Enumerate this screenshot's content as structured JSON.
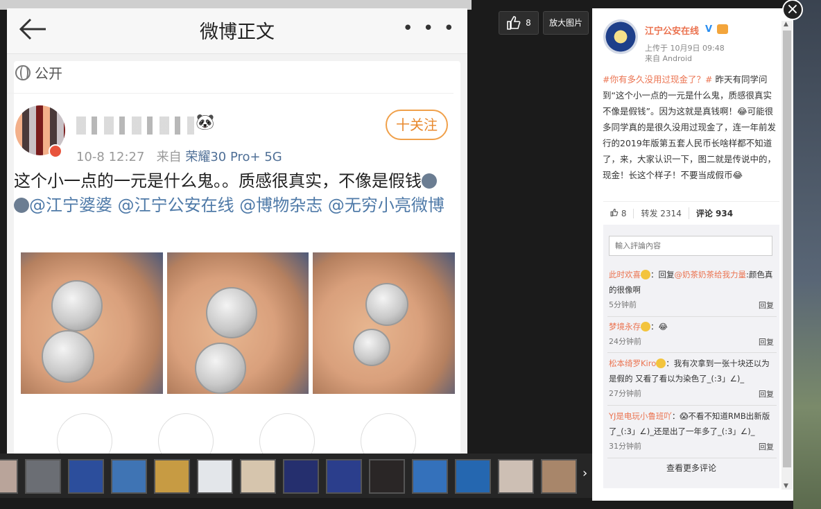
{
  "image_viewer": {
    "like_count": "8",
    "zoom_label": "放大图片",
    "close_label": "×",
    "next_label": "›",
    "thumbnail_count": "14"
  },
  "phone_screenshot": {
    "title": "微博正文",
    "more": "• • •",
    "visibility": "公开",
    "post_time": "10-8 12:27",
    "from_prefix": "来自",
    "device": "荣耀30 Pro+ 5G",
    "follow_label": "十关注",
    "text_main": "这个小一点的一元是什么鬼。。质感很真实，不像是假钱",
    "mentions": "@江宁婆婆 @江宁公安在线 @博物杂志 @无穷小亮微博"
  },
  "panel": {
    "author": "江宁公安在线",
    "verified_mark": "V",
    "upload_time": "上传于 10月9日 09:48",
    "source": "来自 Android",
    "tag": "#你有多久没用过现金了？#",
    "body": "昨天有同学问到“这个小一点的一元是什么鬼，质感很真实不像是假钱”。因为这就是真钱啊！😂可能很多同学真的是很久没用过现金了，连一年前发行的2019年版第五套人民币长啥样都不知道了，来，大家认识一下，图二就是传说中的，现金！长这个样子！不要当成假币😂",
    "actions": {
      "like": "8",
      "repost": "转发 2314",
      "comment": "评论 934"
    },
    "comment_placeholder": "輸入評論內容",
    "comments": [
      {
        "user": "此时欢喜",
        "text": "：回复",
        "mention": "@奶茶奶茶给我力量",
        "text2": ":颜色真的很像啊",
        "time": "5分钟前",
        "reply": "回复"
      },
      {
        "user": "梦境永存",
        "text": "：😂",
        "mention": "",
        "text2": "",
        "time": "24分钟前",
        "reply": "回复"
      },
      {
        "user": "松本绮罗Kiro",
        "text": "：我有次拿到一张十块还以为是假的 又看了看以为染色了_(:3」∠)_",
        "mention": "",
        "text2": "",
        "time": "27分钟前",
        "reply": "回复"
      },
      {
        "user": "YJ是电玩小鲁班吖",
        "text": "：😱不看不知道RMB出新版了_(:3」∠)_还是出了一年多了_(:3」∠)_",
        "mention": "",
        "text2": "",
        "time": "31分钟前",
        "reply": "回复"
      }
    ],
    "more_comments": "查看更多评论"
  },
  "colors": {
    "accent_orange": "#eb7350",
    "link_blue": "#4f7aa8",
    "verified_blue": "#2b8ef0"
  }
}
